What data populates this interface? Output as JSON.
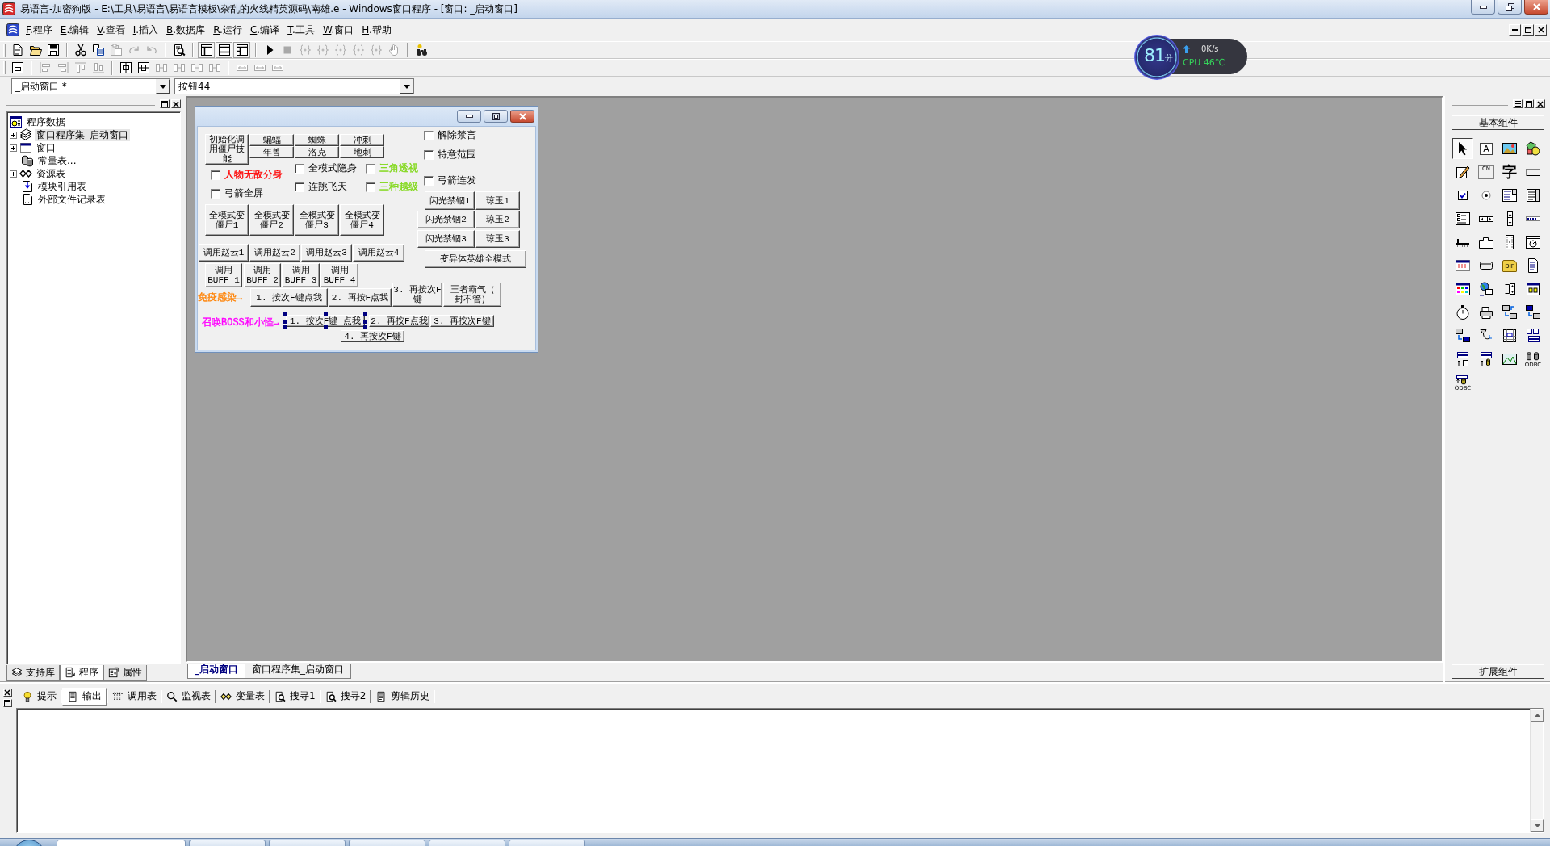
{
  "window": {
    "title": "易语言-加密狗版 - E:\\工具\\易语言\\易语言模板\\杂乱的火线精英源码\\南雄.e - Windows窗口程序 - [窗口: _启动窗口]"
  },
  "menu": [
    "F.程序",
    "E.编辑",
    "V.查看",
    "I.插入",
    "B.数据库",
    "R.运行",
    "C.编译",
    "T.工具",
    "W.窗口",
    "H.帮助"
  ],
  "toolbars": [
    [
      [
        {
          "disabled": false
        },
        {
          "disabled": false
        },
        {
          "disabled": false
        }
      ],
      [
        {
          "disabled": false
        },
        {
          "disabled": false
        },
        {
          "disabled": true
        },
        {
          "disabled": true
        },
        {
          "disabled": true
        }
      ],
      [
        {
          "disabled": false
        }
      ],
      [
        {
          "disabled": false
        },
        {
          "disabled": false
        },
        {
          "disabled": false
        }
      ],
      [
        {
          "disabled": false
        },
        {
          "disabled": true
        },
        {
          "disabled": true
        },
        {
          "disabled": true
        },
        {
          "disabled": true
        },
        {
          "disabled": true
        },
        {
          "disabled": true
        },
        {
          "disabled": true
        }
      ],
      [
        {
          "disabled": false
        }
      ]
    ],
    [
      [
        {
          "disabled": false
        }
      ],
      [
        {
          "disabled": true
        },
        {
          "disabled": true
        },
        {
          "disabled": true
        },
        {
          "disabled": true
        }
      ],
      [
        {
          "disabled": false
        },
        {
          "disabled": false
        },
        {
          "disabled": true
        },
        {
          "disabled": true
        },
        {
          "disabled": true
        },
        {
          "disabled": true
        }
      ],
      [
        {
          "disabled": true
        },
        {
          "disabled": true
        },
        {
          "disabled": true
        }
      ]
    ]
  ],
  "selectors": [
    {
      "value": "_启动窗口 *"
    },
    {
      "value": "按钮44"
    }
  ],
  "left_panel": {
    "tree": [
      {
        "label": "程序数据",
        "selected": false,
        "children": [
          {
            "label": "窗口程序集_启动窗口",
            "expanded": false,
            "selected": true
          },
          {
            "label": "窗口",
            "expanded": false,
            "selected": false
          },
          {
            "label": "常量表...",
            "selected": false
          },
          {
            "label": "资源表",
            "expanded": false,
            "selected": false
          },
          {
            "label": "模块引用表",
            "selected": false
          },
          {
            "label": "外部文件记录表",
            "selected": false
          }
        ]
      }
    ],
    "tabs": [
      {
        "label": "支持库",
        "selected": false
      },
      {
        "label": "程序",
        "selected": true
      },
      {
        "label": "属性",
        "selected": false
      }
    ]
  },
  "designer": {
    "form": {
      "controls": [
        {
          "kind": "button",
          "text": "初始化调用僵尸技能",
          "selected": false
        },
        {
          "kind": "button",
          "text": "蝙蝠",
          "selected": false
        },
        {
          "kind": "button",
          "text": "蜘蛛",
          "selected": false
        },
        {
          "kind": "button",
          "text": "冲刺",
          "selected": false
        },
        {
          "kind": "checkbox",
          "text": "解除禁言",
          "checked": false,
          "selected": false
        },
        {
          "kind": "button",
          "text": "年兽",
          "selected": false
        },
        {
          "kind": "button",
          "text": "洛克",
          "selected": false
        },
        {
          "kind": "button",
          "text": "地刺",
          "selected": false
        },
        {
          "kind": "checkbox",
          "text": "特意范围",
          "checked": false,
          "selected": false
        },
        {
          "kind": "checkbox",
          "text": "人物无敌分身",
          "checked": false,
          "color": "#ff0000",
          "selected": false
        },
        {
          "kind": "checkbox",
          "text": "全模式隐身",
          "checked": false,
          "selected": false
        },
        {
          "kind": "checkbox",
          "text": "三角透视",
          "checked": false,
          "color": "#80d818",
          "selected": false
        },
        {
          "kind": "checkbox",
          "text": "弓箭连发",
          "checked": false,
          "selected": false
        },
        {
          "kind": "checkbox",
          "text": "弓箭全屏",
          "checked": false,
          "selected": false
        },
        {
          "kind": "checkbox",
          "text": "连跳飞天",
          "checked": false,
          "selected": false
        },
        {
          "kind": "checkbox",
          "text": "三种越级",
          "checked": false,
          "color": "#80d818",
          "selected": false
        },
        {
          "kind": "button",
          "text": "闪光禁锢1",
          "selected": false
        },
        {
          "kind": "button",
          "text": "琼玉1",
          "selected": false
        },
        {
          "kind": "button",
          "text": "全模式变僵尸1",
          "selected": false
        },
        {
          "kind": "button",
          "text": "全模式变僵尸2",
          "selected": false
        },
        {
          "kind": "button",
          "text": "全模式变僵尸3",
          "selected": false
        },
        {
          "kind": "button",
          "text": "全模式变僵尸4",
          "selected": false
        },
        {
          "kind": "button",
          "text": "闪光禁锢2",
          "selected": false
        },
        {
          "kind": "button",
          "text": "琼玉2",
          "selected": false
        },
        {
          "kind": "button",
          "text": "闪光禁锢3",
          "selected": false
        },
        {
          "kind": "button",
          "text": "琼玉3",
          "selected": false
        },
        {
          "kind": "button",
          "text": "调用赵云1",
          "selected": false
        },
        {
          "kind": "button",
          "text": "调用赵云2",
          "selected": false
        },
        {
          "kind": "button",
          "text": "调用赵云3",
          "selected": false
        },
        {
          "kind": "button",
          "text": "调用赵云4",
          "selected": false
        },
        {
          "kind": "button",
          "text": "变异体英雄全模式",
          "selected": false
        },
        {
          "kind": "button",
          "text": "调用BUFF 1",
          "selected": false
        },
        {
          "kind": "button",
          "text": "调用BUFF 2",
          "selected": false
        },
        {
          "kind": "button",
          "text": "调用BUFF 3",
          "selected": false
        },
        {
          "kind": "button",
          "text": "调用BUFF 4",
          "selected": false
        },
        {
          "kind": "label",
          "text": "免疫感染→",
          "color": "#ff8000",
          "selected": false
        },
        {
          "kind": "button",
          "text": "1. 按次F键点我",
          "selected": false
        },
        {
          "kind": "button",
          "text": "2. 再按F点我",
          "selected": false
        },
        {
          "kind": "button",
          "text": "3. 再按次F键",
          "selected": false
        },
        {
          "kind": "button",
          "text": "王者霸气（封不管）",
          "selected": false
        },
        {
          "kind": "label",
          "text": "召唤BOSS和小怪→",
          "color": "#ff00ff",
          "selected": false
        },
        {
          "kind": "button",
          "text": "1. 按次F键 点我",
          "selected": true
        },
        {
          "kind": "button",
          "text": "2. 再按F点我",
          "selected": false
        },
        {
          "kind": "button",
          "text": "3. 再按次F键",
          "selected": false
        },
        {
          "kind": "button",
          "text": "4. 再按次F键",
          "selected": false
        }
      ]
    },
    "tabs": [
      {
        "label": "_启动窗口",
        "selected": true
      },
      {
        "label": "窗口程序集_启动窗口",
        "selected": false
      }
    ]
  },
  "toolbox": {
    "title": "基本组件",
    "items": [
      {
        "selected": true
      },
      {
        "selected": false,
        "caption": "A"
      },
      {
        "selected": false
      },
      {
        "selected": false
      },
      {
        "selected": false
      },
      {
        "selected": false,
        "caption": "CN"
      },
      {
        "selected": false,
        "caption": "字"
      },
      {
        "selected": false
      },
      {
        "selected": false
      },
      {
        "selected": false
      },
      {
        "selected": false
      },
      {
        "selected": false
      },
      {
        "selected": false
      },
      {
        "selected": false
      },
      {
        "selected": false
      },
      {
        "selected": false
      },
      {
        "selected": false
      },
      {
        "selected": false
      },
      {
        "selected": false
      },
      {
        "selected": false
      },
      {
        "selected": false
      },
      {
        "selected": false
      },
      {
        "selected": false,
        "caption": "DIF"
      },
      {
        "selected": false
      },
      {
        "selected": false
      },
      {
        "selected": false
      },
      {
        "selected": false
      },
      {
        "selected": false
      },
      {
        "selected": false
      },
      {
        "selected": false
      },
      {
        "selected": false
      },
      {
        "selected": false
      },
      {
        "selected": false
      },
      {
        "selected": false
      },
      {
        "selected": false
      },
      {
        "selected": false
      },
      {
        "selected": false
      },
      {
        "selected": false
      },
      {
        "selected": false
      },
      {
        "selected": false,
        "caption": "ODBC"
      },
      {
        "selected": false,
        "caption": "ODBC"
      }
    ],
    "footer": "扩展组件"
  },
  "output_panel": {
    "tabs": [
      {
        "label": "提示",
        "selected": false
      },
      {
        "label": "输出",
        "selected": true
      },
      {
        "label": "调用表",
        "selected": false
      },
      {
        "label": "监视表",
        "selected": false
      },
      {
        "label": "变量表",
        "selected": false
      },
      {
        "label": "搜寻1",
        "selected": false
      },
      {
        "label": "搜寻2",
        "selected": false
      },
      {
        "label": "剪辑历史",
        "selected": false
      }
    ]
  },
  "widget": {
    "score": "81",
    "score_unit": "分",
    "upload_speed": "0K/s",
    "cpu": "CPU 46℃"
  }
}
